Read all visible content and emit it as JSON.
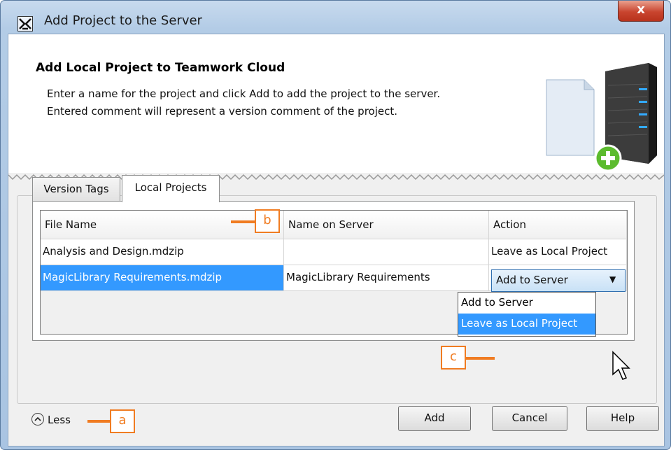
{
  "window": {
    "title": "Add Project to the Server",
    "close_label": "x"
  },
  "header": {
    "title": "Add Local Project to Teamwork Cloud",
    "desc_line1": "Enter a name for the project and click Add to add the project to the server.",
    "desc_line2": "Entered comment will represent a version comment of the project."
  },
  "tabs": [
    {
      "label": "Version Tags"
    },
    {
      "label": "Local Projects"
    }
  ],
  "table": {
    "headers": [
      "File Name",
      "Name on Server",
      "Action"
    ],
    "rows": [
      {
        "file": "Analysis and Design.mdzip",
        "server_name": "",
        "action": "Leave as Local Project"
      },
      {
        "file": "MagicLibrary Requirements.mdzip",
        "server_name": "MagicLibrary Requirements",
        "action": "Add to Server"
      }
    ]
  },
  "dropdown": {
    "options": [
      "Add to Server",
      "Leave as Local Project"
    ],
    "highlighted": "Leave as Local Project"
  },
  "callouts": {
    "a": "a",
    "b": "b",
    "c": "c"
  },
  "footer": {
    "less_label": "Less",
    "add_label": "Add",
    "cancel_label": "Cancel",
    "help_label": "Help"
  },
  "colors": {
    "accent_callout": "#f07c22",
    "selection": "#3399ff",
    "close": "#c9452f"
  }
}
